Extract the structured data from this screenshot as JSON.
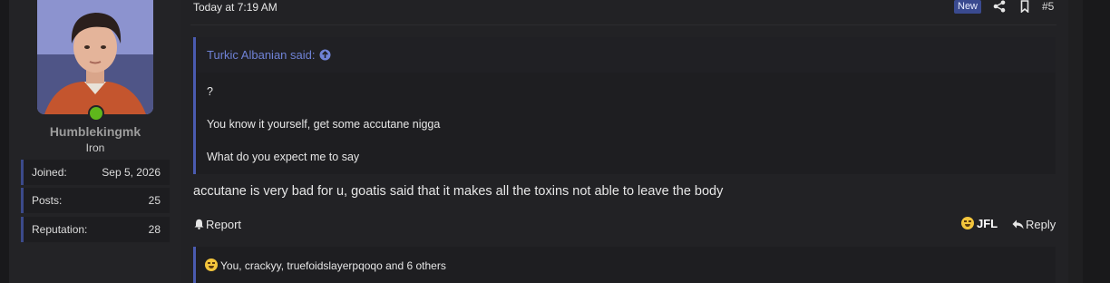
{
  "user": {
    "username": "Humblekingmk",
    "title": "Iron",
    "stats": [
      {
        "label": "Joined:",
        "value": "Sep 5, 2026"
      },
      {
        "label": "Posts:",
        "value": "25"
      },
      {
        "label": "Reputation:",
        "value": "28"
      }
    ]
  },
  "post": {
    "date": "Today at 7:19 AM",
    "new_badge": "New",
    "number": "#5",
    "quote": {
      "author": "Turkic Albanian said:",
      "lines": [
        "?",
        "You know it yourself, get some accutane nigga",
        "What do you expect me to say"
      ]
    },
    "body": "accutane is very bad for u, goatis said that it makes all the toxins not able to leave the body",
    "actions": {
      "report": "Report",
      "reaction": "JFL",
      "reply": "Reply"
    },
    "reactions_text": "You, crackyy, truefoidslayerpqoqo and 6 others"
  },
  "icons": {
    "share": "share-icon",
    "bookmark": "bookmark-icon",
    "bell": "bell-icon",
    "reply": "reply-icon",
    "quote_up": "arrow-up-circle-icon",
    "reaction": "laughing-crying-emoji-icon"
  },
  "colors": {
    "accent": "#4a5bb0",
    "quote_author": "#6f82d6",
    "online": "#5fb71c",
    "new_badge": "#3a4a8f"
  }
}
